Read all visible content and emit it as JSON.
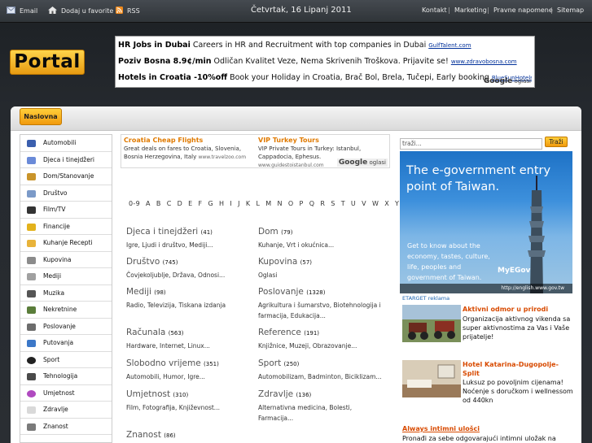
{
  "topbar": {
    "email": "Email",
    "favorite": "Dodaj u favorite",
    "rss": "RSS",
    "date": "Četvrtak, 16 Lipanj 2011",
    "links": [
      "Kontakt",
      "Marketing",
      "Pravne napomene",
      "Sitemap"
    ]
  },
  "logo": "Portal",
  "top_ads": [
    {
      "title": "HR Jobs in Dubai",
      "text": "Careers in HR and Recruitment with top companies in Dubai",
      "url": "GulfTalent.com"
    },
    {
      "title": "Poziv Bosna 8.9¢/min",
      "text": "Odličan Kvalitet Veze, Nema Skrivenih Troškova. Prijavite se!",
      "url": "www.zdravobosna.com"
    },
    {
      "title": "Hotels in Croatia -10%off",
      "text": "Book your Holiday in Croatia, Brač Bol, Brela, Tučepi, Early booking",
      "url": "BlueSunHotels.com/Firs"
    }
  ],
  "google_ads_label": {
    "brand": "Google",
    "suffix": "oglasi"
  },
  "nav_tab": "Naslovna",
  "sidebar": [
    {
      "label": "Automobili",
      "icon": "car-icon"
    },
    {
      "label": "Djeca i tinejdžeri",
      "icon": "kids-icon"
    },
    {
      "label": "Dom/Stanovanje",
      "icon": "home-icon"
    },
    {
      "label": "Društvo",
      "icon": "people-icon"
    },
    {
      "label": "Film/TV",
      "icon": "film-icon"
    },
    {
      "label": "Financije",
      "icon": "finance-icon"
    },
    {
      "label": "Kuhanje Recepti",
      "icon": "cooking-icon"
    },
    {
      "label": "Kupovina",
      "icon": "cart-icon"
    },
    {
      "label": "Mediji",
      "icon": "media-icon"
    },
    {
      "label": "Muzika",
      "icon": "music-icon"
    },
    {
      "label": "Nekretnine",
      "icon": "realestate-icon"
    },
    {
      "label": "Poslovanje",
      "icon": "business-icon"
    },
    {
      "label": "Putovanja",
      "icon": "travel-icon"
    },
    {
      "label": "Sport",
      "icon": "sport-icon"
    },
    {
      "label": "Tehnologija",
      "icon": "tech-icon"
    },
    {
      "label": "Umjetnost",
      "icon": "art-icon"
    },
    {
      "label": "Zdravlje",
      "icon": "health-icon"
    },
    {
      "label": "Znanost",
      "icon": "science-icon"
    }
  ],
  "mid_ads": [
    {
      "title": "Croatia Cheap Flights",
      "text": "Great deals on fares to Croatia, Slovenia, Bosnia Herzegovina, Italy",
      "url": "www.travelzoo.com"
    },
    {
      "title": "VIP Turkey Tours",
      "text": "VIP Private Tours in Turkey: Istanbul, Cappadocia, Ephesus.",
      "url": "www.guidestoistanbul.com"
    }
  ],
  "alphabet": [
    "0-9",
    "A",
    "B",
    "C",
    "D",
    "E",
    "F",
    "G",
    "H",
    "I",
    "J",
    "K",
    "L",
    "M",
    "N",
    "O",
    "P",
    "Q",
    "R",
    "S",
    "T",
    "U",
    "V",
    "W",
    "X",
    "Y",
    "Z"
  ],
  "categories": [
    {
      "title": "Djeca i tinejdžeri",
      "count": "(41)",
      "subs": "Igre, Ljudi i društvo, Mediji..."
    },
    {
      "title": "Dom",
      "count": "(79)",
      "subs": "Kuhanje, Vrt i okućnica..."
    },
    {
      "title": "Društvo",
      "count": "(745)",
      "subs": "Čovjekoljublje, Država, Odnosi..."
    },
    {
      "title": "Kupovina",
      "count": "(57)",
      "subs": "Oglasi"
    },
    {
      "title": "Mediji",
      "count": "(98)",
      "subs": "Radio, Televizija, Tiskana izdanja"
    },
    {
      "title": "Poslovanje",
      "count": "(1328)",
      "subs": "Agrikultura i šumarstvo, Biotehnologija i farmacija, Edukacija..."
    },
    {
      "title": "Računala",
      "count": "(563)",
      "subs": "Hardware, Internet, Linux..."
    },
    {
      "title": "Reference",
      "count": "(191)",
      "subs": "Knjižnice, Muzeji, Obrazovanje..."
    },
    {
      "title": "Slobodno vrijeme",
      "count": "(351)",
      "subs": "Automobili, Humor, Igre..."
    },
    {
      "title": "Sport",
      "count": "(250)",
      "subs": "Automobilizam, Badminton, Biciklizam..."
    },
    {
      "title": "Umjetnost",
      "count": "(310)",
      "subs": "Film, Fotografija, Književnost..."
    },
    {
      "title": "Zdravlje",
      "count": "(136)",
      "subs": "Alternativna medicina, Bolesti, Farmacija..."
    },
    {
      "title": "Znanost",
      "count": "(86)",
      "subs": ""
    }
  ],
  "search": {
    "placeholder": "traži...",
    "button": "Traži"
  },
  "banner": {
    "headline": "The e-government entry point of Taiwan.",
    "subtext": "Get to know about the economy, tastes, culture, life, peoples and government of Taiwan.",
    "brand": "MyEGov",
    "url": "http://english.www.gov.tw"
  },
  "etarget": "ETARGET reklama",
  "right_ads": [
    {
      "title": "Aktivni odmor u prirodi",
      "text": "Organizacija aktivnog vikenda sa super aktivnostima za Vas i Vaše prijatelje!"
    },
    {
      "title": "Hotel Katarina-Dugopolje-Split",
      "text": "Luksuz po povoljnim cijenama! Noćenje s doručkom i wellnessom od 440kn"
    }
  ],
  "bottom_ad": {
    "title": "Always intimni ulošci",
    "text": "Pronađi za sebe odgovarajući intimni uložak na"
  }
}
